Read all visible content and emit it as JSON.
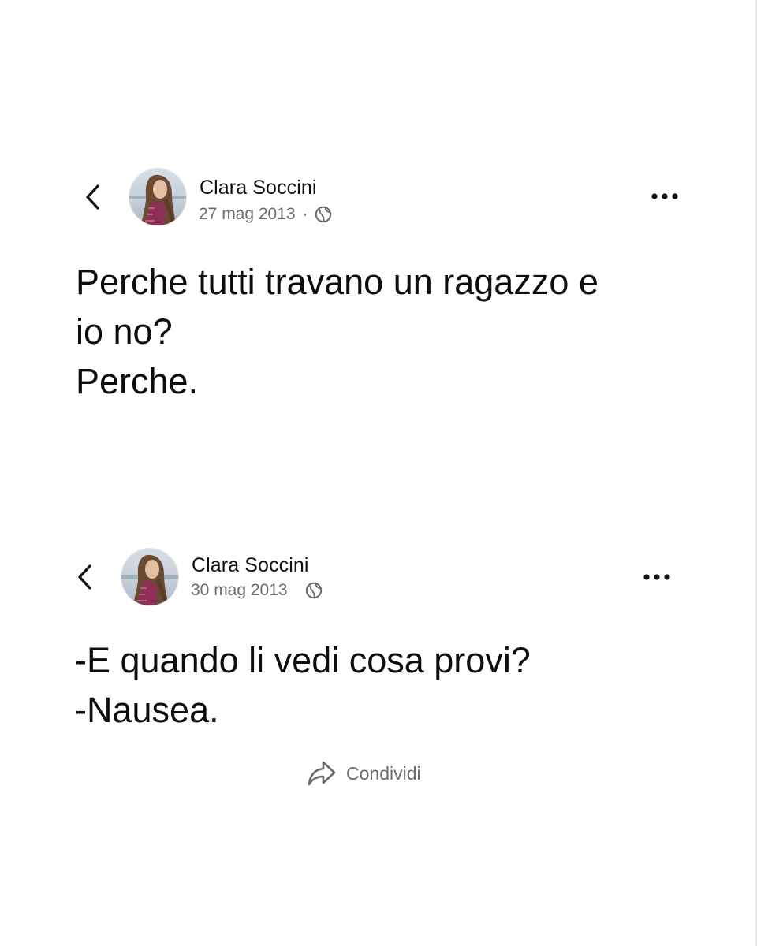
{
  "posts": [
    {
      "author": "Clara Soccini",
      "date": "27 mag 2013",
      "separator": "·",
      "privacy_icon": "globe-icon",
      "lines": [
        "Perche tutti travano un ragazzo e",
        "io no?",
        "Perche."
      ]
    },
    {
      "author": "Clara Soccini",
      "date": "30 mag 2013",
      "privacy_icon": "globe-icon",
      "lines": [
        "-E quando li vedi cosa provi?",
        "-Nausea."
      ]
    }
  ],
  "share": {
    "label": "Condividi",
    "icon": "share-arrow-icon"
  },
  "icons": {
    "back": "chevron-left-icon",
    "more": "more-horizontal-icon"
  },
  "colors": {
    "text": "#111111",
    "meta": "#6b6b6b",
    "background": "#ffffff"
  }
}
